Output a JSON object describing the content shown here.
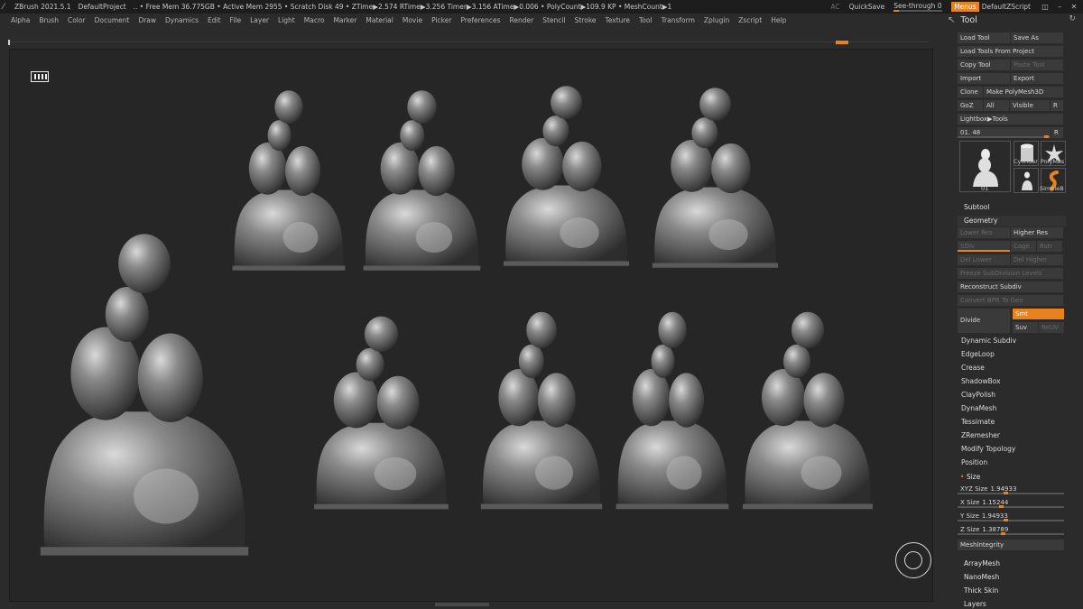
{
  "titlebar": {
    "app": "ZBrush 2021.5.1",
    "project": "DefaultProject",
    "status": "..  • Free Mem 36.775GB • Active Mem 2955 • Scratch Disk 49 • ZTime▶2.574 RTime▶3.256 Timer▶3.156 ATime▶0.006 • PolyCount▶109.9 KP • MeshCount▶1",
    "ac": "AC",
    "quicksave": "QuickSave",
    "seethrough": "See-through 0",
    "seethrough_level": 0,
    "menus": "Menus",
    "zscript": "DefaultZScript"
  },
  "menubar": [
    "Alpha",
    "Brush",
    "Color",
    "Document",
    "Draw",
    "Dynamics",
    "Edit",
    "File",
    "Layer",
    "Light",
    "Macro",
    "Marker",
    "Material",
    "Movie",
    "Picker",
    "Preferences",
    "Render",
    "Stencil",
    "Stroke",
    "Texture",
    "Tool",
    "Transform",
    "Zplugin",
    "Zscript",
    "Help"
  ],
  "tray": {
    "title": "Tool",
    "buttons": {
      "load_tool": "Load Tool",
      "save_as": "Save As",
      "load_from_project": "Load Tools From Project",
      "copy_tool": "Copy Tool",
      "paste_tool": "Paste Tool",
      "import": "Import",
      "export": "Export",
      "clone": "Clone",
      "make_polymesh": "Make PolyMesh3D",
      "goz": "GoZ",
      "all": "All",
      "visible": "Visible",
      "r": "R",
      "lightbox_tools": "Lightbox▶Tools",
      "tool_slider": "01. 48",
      "r2": "R"
    },
    "thumbs": {
      "main_label": "01",
      "cylinder": "Cylinder",
      "polymesh": "PolyMes",
      "small_label": "01",
      "simpleb": "SimpleB"
    },
    "subtool": "Subtool",
    "geometry": "Geometry",
    "geo": {
      "lower_res": "Lower Res",
      "higher_res": "Higher Res",
      "sdiv": "SDiv",
      "cage": "Cage",
      "rstr": "Rstr",
      "del_lower": "Del Lower",
      "del_higher": "Del Higher",
      "freeze": "Freeze SubDivision Levels",
      "reconstruct": "Reconstruct Subdiv",
      "convert_bpr": "Convert BPR To Geo",
      "divide": "Divide",
      "smt": "Smt",
      "suv": "Suv",
      "reuv": "ReUV"
    },
    "items": [
      "Dynamic Subdiv",
      "EdgeLoop",
      "Crease",
      "ShadowBox",
      "ClayPolish",
      "DynaMesh",
      "Tessimate",
      "ZRemesher",
      "Modify Topology",
      "Position"
    ],
    "size": {
      "title": "Size",
      "xyz_label": "XYZ Size",
      "xyz": "1.94933",
      "x_label": "X Size",
      "x": "1.15244",
      "y_label": "Y Size",
      "y": "1.94933",
      "z_label": "Z Size",
      "z": "1.38789"
    },
    "mesh_integrity": "MeshIntegrity",
    "bottom": [
      "ArrayMesh",
      "NanoMesh",
      "Thick Skin",
      "Layers"
    ]
  },
  "colors": {
    "accent": "#e8821e",
    "canvas": "#262626",
    "ui": "#2b2b2b"
  },
  "icons": {
    "app": "zbrush-logo-icon",
    "perspective": "perspective-grid-icon",
    "gyro": "gyro-icon",
    "tool": "tool-icon",
    "refresh": "refresh-icon"
  }
}
